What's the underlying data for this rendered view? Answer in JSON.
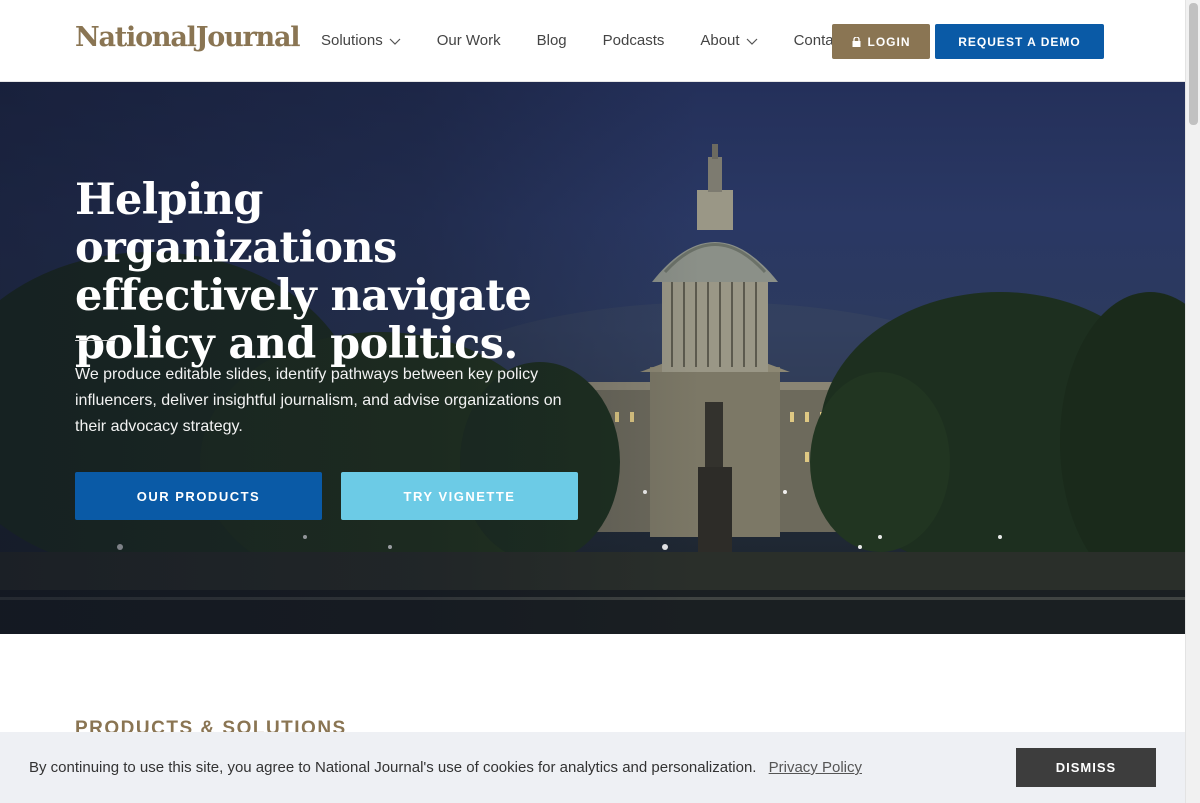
{
  "header": {
    "logo_text": "NationalJournal",
    "nav": [
      {
        "label": "Solutions",
        "has_dropdown": true
      },
      {
        "label": "Our Work",
        "has_dropdown": false
      },
      {
        "label": "Blog",
        "has_dropdown": false
      },
      {
        "label": "Podcasts",
        "has_dropdown": false
      },
      {
        "label": "About",
        "has_dropdown": true
      },
      {
        "label": "Contact",
        "has_dropdown": false
      }
    ],
    "login_label": "LOGIN",
    "demo_label": "REQUEST A DEMO"
  },
  "hero": {
    "title": "Helping organizations effectively navigate policy and politics.",
    "subtitle": "We produce editable slides, identify pathways between key policy influencers, deliver insightful journalism, and advise organizations on their advocacy strategy.",
    "primary_button": "OUR PRODUCTS",
    "secondary_button": "TRY VIGNETTE"
  },
  "section": {
    "heading": "PRODUCTS & SOLUTIONS"
  },
  "cookie_bar": {
    "message": "By continuing to use this site, you agree to National Journal's use of cookies for analytics and personalization.",
    "link_label": "Privacy Policy",
    "dismiss_label": "DISMISS"
  },
  "colors": {
    "brand_gold": "#8a7553",
    "brand_blue": "#0a5aa6",
    "accent_cyan": "#6ccbe6",
    "dismiss_dark": "#3d3d3d"
  },
  "icons": {
    "login": "lock-icon",
    "dropdown": "chevron-down-icon"
  }
}
